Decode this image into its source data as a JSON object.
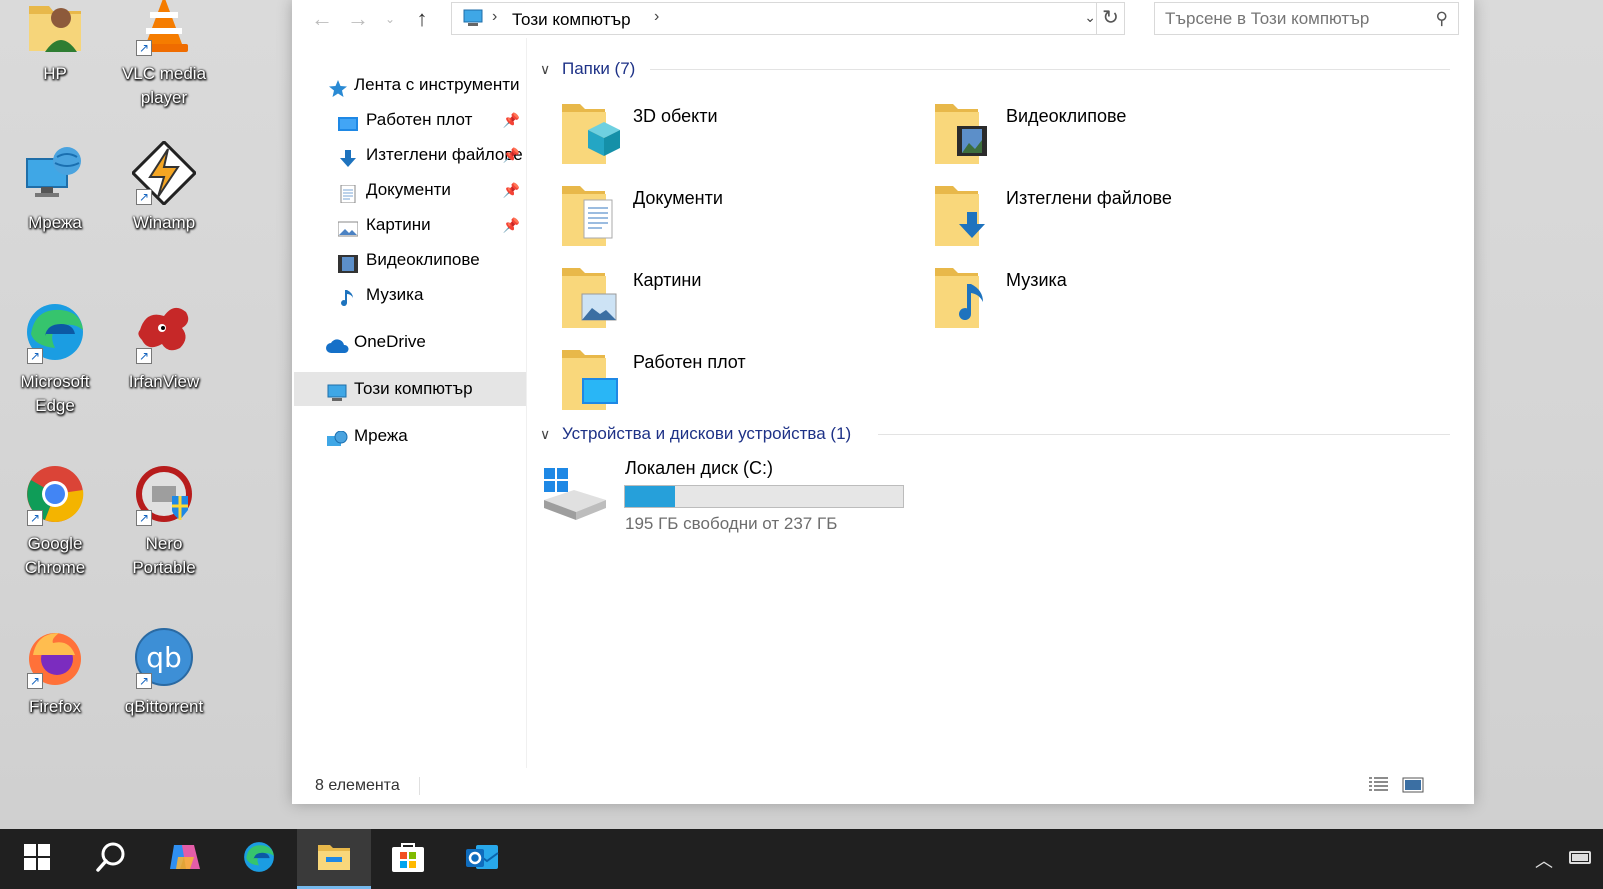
{
  "desktop": {
    "icons": [
      {
        "label": "HP",
        "icon": "user-folder-icon"
      },
      {
        "label": "VLC media player",
        "icon": "vlc-icon"
      },
      {
        "label": "Мрежа",
        "icon": "network-icon"
      },
      {
        "label": "Winamp",
        "icon": "winamp-icon"
      },
      {
        "label": "Microsoft Edge",
        "icon": "edge-icon"
      },
      {
        "label": "IrfanView",
        "icon": "irfanview-icon"
      },
      {
        "label": "Google Chrome",
        "icon": "chrome-icon"
      },
      {
        "label": "Nero Portable",
        "icon": "nero-icon"
      },
      {
        "label": "Firefox",
        "icon": "firefox-icon"
      },
      {
        "label": "qBittorrent",
        "icon": "qbittorrent-icon"
      }
    ]
  },
  "explorer": {
    "address": {
      "crumb": "Този компютър",
      "search_placeholder": "Търсене в Този компютър"
    },
    "nav_pane": {
      "quick_access": "Лента с инструменти",
      "items": [
        {
          "label": "Работен плот",
          "pinned": true
        },
        {
          "label": "Изтеглени файлове",
          "pinned": true
        },
        {
          "label": "Документи",
          "pinned": true
        },
        {
          "label": "Картини",
          "pinned": true
        },
        {
          "label": "Видеоклипове",
          "pinned": false
        },
        {
          "label": "Музика",
          "pinned": false
        }
      ],
      "onedrive": "OneDrive",
      "this_pc": "Този компютър",
      "network": "Мрежа"
    },
    "folders_group": {
      "title": "Папки (7)",
      "folders": [
        {
          "name": "3D обекти",
          "icon": "3d-objects-folder-icon"
        },
        {
          "name": "Видеоклипове",
          "icon": "videos-folder-icon"
        },
        {
          "name": "Документи",
          "icon": "documents-folder-icon"
        },
        {
          "name": "Изтеглени файлове",
          "icon": "downloads-folder-icon"
        },
        {
          "name": "Картини",
          "icon": "pictures-folder-icon"
        },
        {
          "name": "Музика",
          "icon": "music-folder-icon"
        },
        {
          "name": "Работен плот",
          "icon": "desktop-folder-icon"
        }
      ]
    },
    "devices_group": {
      "title": "Устройства и дискови устройства (1)",
      "drive": {
        "name": "Локален диск (C:)",
        "free_text": "195 ГБ свободни от 237 ГБ",
        "used_fraction": 0.18
      }
    },
    "status": {
      "item_count": "8 елемента"
    }
  },
  "taskbar": {
    "items": [
      {
        "name": "start-icon",
        "active": false
      },
      {
        "name": "search-icon",
        "active": false
      },
      {
        "name": "copilot-icon",
        "active": false
      },
      {
        "name": "edge-icon",
        "active": false
      },
      {
        "name": "file-explorer-icon",
        "active": true
      },
      {
        "name": "store-icon",
        "active": false
      },
      {
        "name": "outlook-icon",
        "active": false
      }
    ]
  },
  "colors": {
    "accent": "#26a0da",
    "group_header": "#1e3287",
    "taskbar": "#202020"
  }
}
